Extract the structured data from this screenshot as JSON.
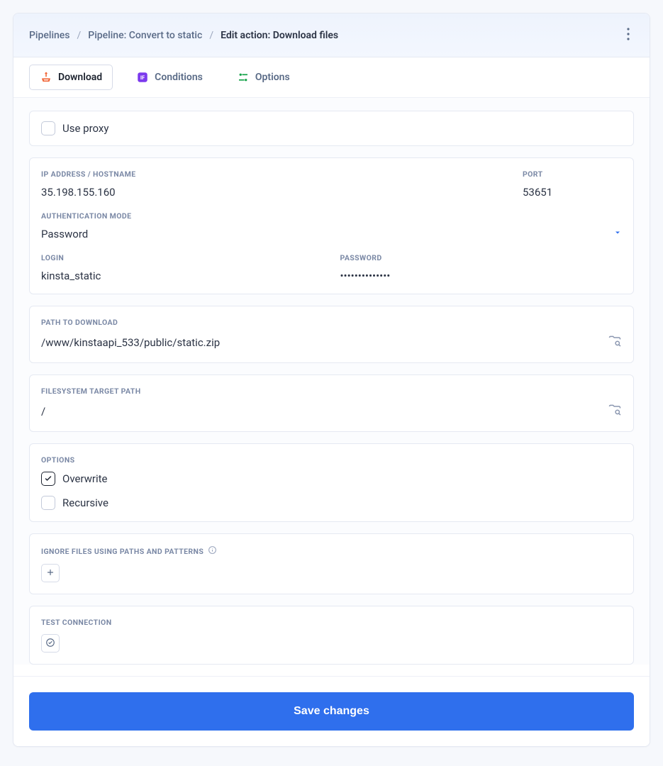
{
  "breadcrumb": {
    "pipelines": "Pipelines",
    "pipeline": "Pipeline: Convert to static",
    "current": "Edit action: Download files"
  },
  "tabs": {
    "download": "Download",
    "conditions": "Conditions",
    "options": "Options"
  },
  "proxy": {
    "label": "Use proxy"
  },
  "connection": {
    "ip_label": "IP ADDRESS / HOSTNAME",
    "ip_value": "35.198.155.160",
    "port_label": "PORT",
    "port_value": "53651",
    "auth_label": "AUTHENTICATION MODE",
    "auth_value": "Password",
    "login_label": "LOGIN",
    "login_value": "kinsta_static",
    "password_label": "PASSWORD",
    "password_value": "••••••••••••••"
  },
  "download_path": {
    "label": "PATH TO DOWNLOAD",
    "value": "/www/kinstaapi_533/public/static.zip"
  },
  "target_path": {
    "label": "FILESYSTEM TARGET PATH",
    "value": "/"
  },
  "options": {
    "label": "OPTIONS",
    "overwrite": "Overwrite",
    "recursive": "Recursive"
  },
  "ignore": {
    "label": "IGNORE FILES USING PATHS AND PATTERNS"
  },
  "test": {
    "label": "TEST CONNECTION"
  },
  "footer": {
    "save": "Save changes"
  }
}
